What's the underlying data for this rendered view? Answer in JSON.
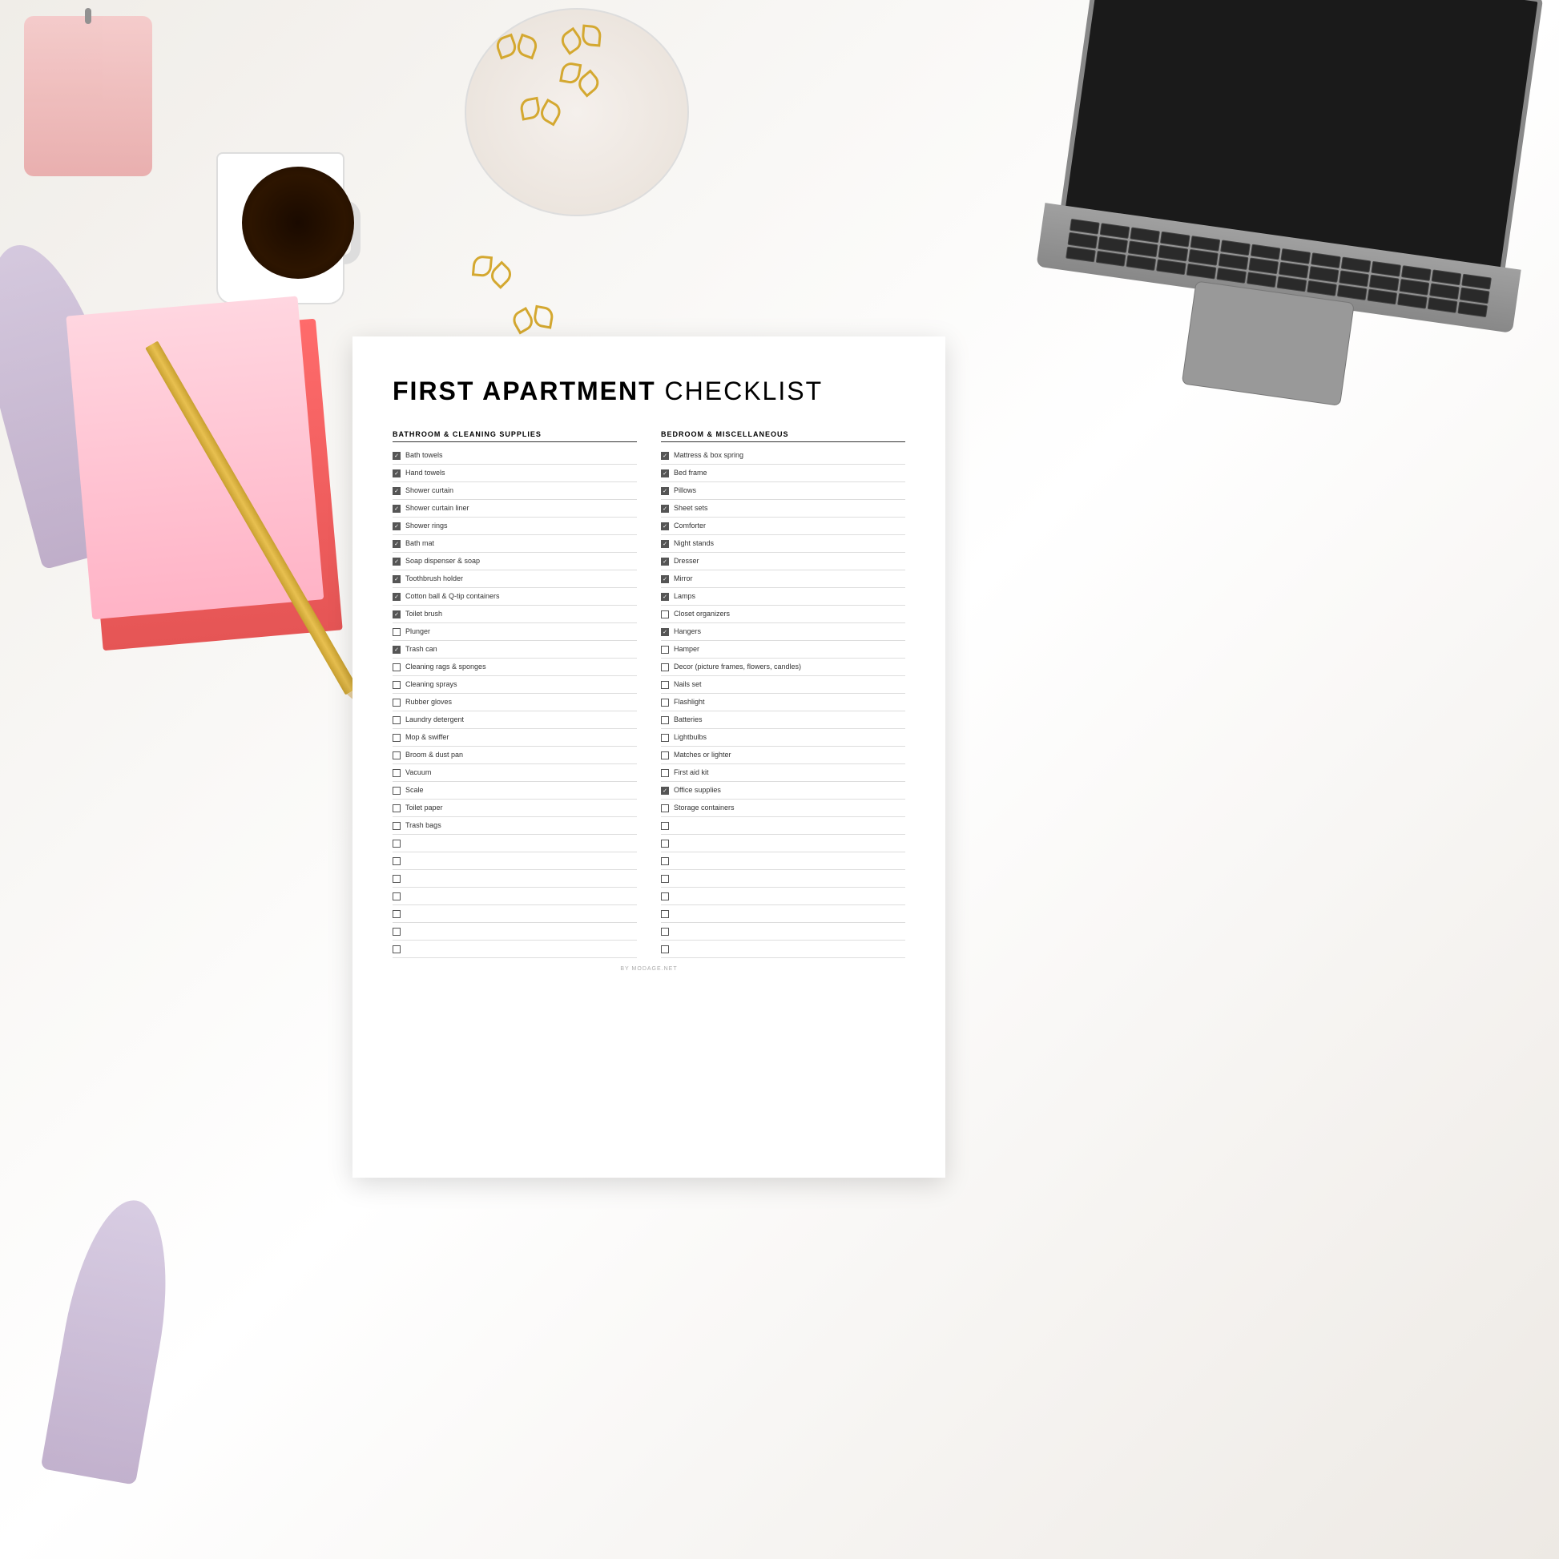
{
  "page": {
    "title": "First Apartment Checklist"
  },
  "checklist": {
    "title_bold": "First Apartment",
    "title_light": "Checklist",
    "column1": {
      "header": "Bathroom & Cleaning Supplies",
      "items": [
        {
          "text": "Bath towels",
          "checked": true
        },
        {
          "text": "Hand towels",
          "checked": true
        },
        {
          "text": "Shower curtain",
          "checked": true
        },
        {
          "text": "Shower curtain liner",
          "checked": true
        },
        {
          "text": "Shower rings",
          "checked": true
        },
        {
          "text": "Bath mat",
          "checked": true
        },
        {
          "text": "Soap dispenser & soap",
          "checked": true
        },
        {
          "text": "Toothbrush holder",
          "checked": true
        },
        {
          "text": "Cotton ball & Q-tip containers",
          "checked": true
        },
        {
          "text": "Toilet brush",
          "checked": true
        },
        {
          "text": "Plunger",
          "checked": false
        },
        {
          "text": "Trash can",
          "checked": true
        },
        {
          "text": "Cleaning rags & sponges",
          "checked": false
        },
        {
          "text": "Cleaning sprays",
          "checked": false
        },
        {
          "text": "Rubber gloves",
          "checked": false
        },
        {
          "text": "Laundry detergent",
          "checked": false
        },
        {
          "text": "Mop & swiffer",
          "checked": false
        },
        {
          "text": "Broom & dust pan",
          "checked": false
        },
        {
          "text": "Vacuum",
          "checked": false
        },
        {
          "text": "Scale",
          "checked": false
        },
        {
          "text": "Toilet paper",
          "checked": false
        },
        {
          "text": "Trash bags",
          "checked": false
        },
        {
          "text": "",
          "checked": false
        },
        {
          "text": "",
          "checked": false
        },
        {
          "text": "",
          "checked": false
        },
        {
          "text": "",
          "checked": false
        },
        {
          "text": "",
          "checked": false
        },
        {
          "text": "",
          "checked": false
        },
        {
          "text": "",
          "checked": false
        }
      ]
    },
    "column2": {
      "header": "Bedroom & Miscellaneous",
      "items": [
        {
          "text": "Mattress & box spring",
          "checked": true
        },
        {
          "text": "Bed frame",
          "checked": true
        },
        {
          "text": "Pillows",
          "checked": true
        },
        {
          "text": "Sheet sets",
          "checked": true
        },
        {
          "text": "Comforter",
          "checked": true
        },
        {
          "text": "Night stands",
          "checked": true
        },
        {
          "text": "Dresser",
          "checked": true
        },
        {
          "text": "Mirror",
          "checked": true
        },
        {
          "text": "Lamps",
          "checked": true
        },
        {
          "text": "Closet organizers",
          "checked": false
        },
        {
          "text": "Hangers",
          "checked": true
        },
        {
          "text": "Hamper",
          "checked": false
        },
        {
          "text": "Decor (picture frames, flowers, candles)",
          "checked": false
        },
        {
          "text": "Nails set",
          "checked": false
        },
        {
          "text": "Flashlight",
          "checked": false
        },
        {
          "text": "Batteries",
          "checked": false
        },
        {
          "text": "Lightbulbs",
          "checked": false
        },
        {
          "text": "Matches or lighter",
          "checked": false
        },
        {
          "text": "First aid kit",
          "checked": false
        },
        {
          "text": "Office supplies",
          "checked": true
        },
        {
          "text": "Storage containers",
          "checked": false
        },
        {
          "text": "",
          "checked": false
        },
        {
          "text": "",
          "checked": false
        },
        {
          "text": "",
          "checked": false
        },
        {
          "text": "",
          "checked": false
        },
        {
          "text": "",
          "checked": false
        },
        {
          "text": "",
          "checked": false
        },
        {
          "text": "",
          "checked": false
        },
        {
          "text": "",
          "checked": false
        }
      ]
    },
    "watermark": "BY MODAGE.NET"
  }
}
